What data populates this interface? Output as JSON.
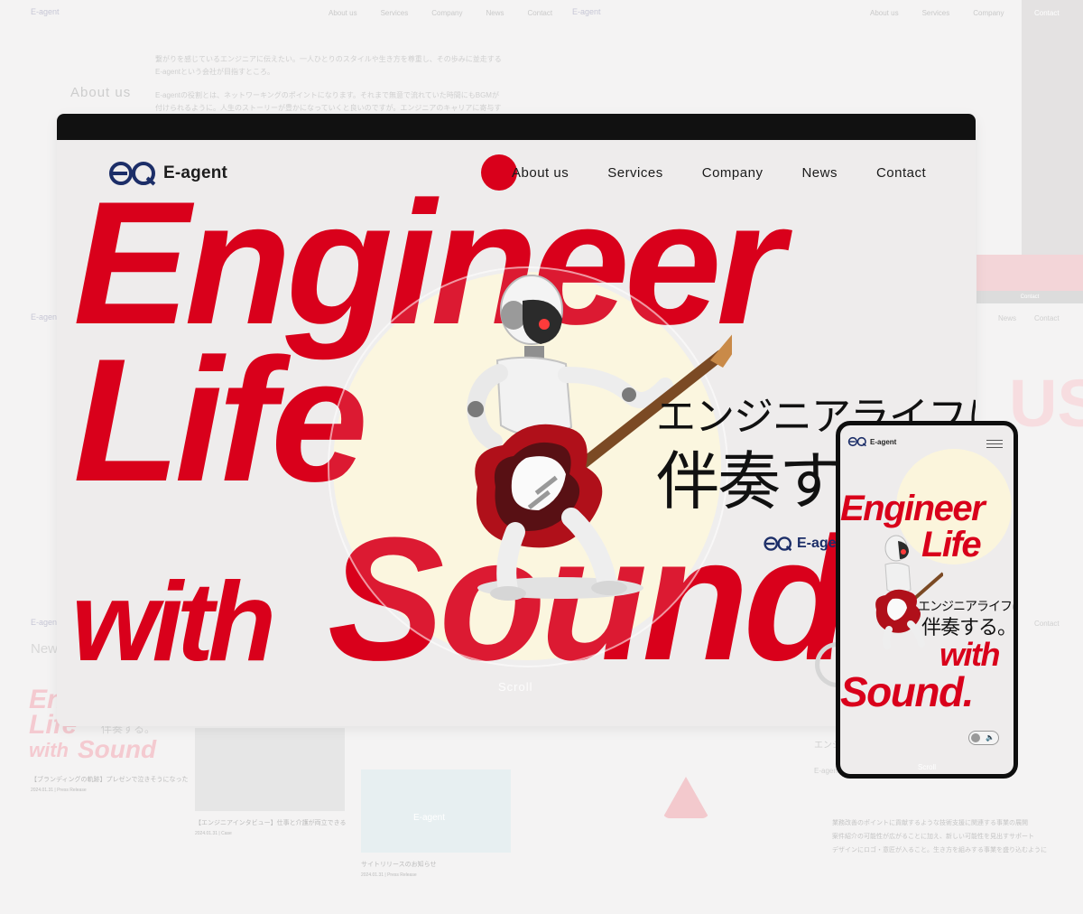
{
  "brand": {
    "name": "E-agent",
    "accent": "#d9001b",
    "logo_color": "#1c2e68"
  },
  "background": {
    "about_heading": "About us",
    "news_heading": "News",
    "nav": [
      "About us",
      "Services",
      "Company",
      "News",
      "Contact"
    ],
    "about_text_1": "繋がりを感じているエンジニアに伝えたい。一人ひとりのスタイルや生き方を尊重し、その歩みに並走する",
    "about_text_2": "E-agentという会社が目指すところ。",
    "about_text_3": "E-agentの役割とは、ネットワーキングのポイントになります。それまで無意で流れていた時間にもBGMが",
    "about_text_4": "付けられるように。人生のストーリーが豊かになっていくと良いのですが。エンジニアのキャリアに寄与す",
    "right_label": "Contact",
    "right_gray": "Contact",
    "us_text": "US",
    "news_1": "【ブランディングの軌跡】プレゼンで泣きそうになった",
    "news_1_meta": "2024.01.31 | Press Release",
    "news_2": "【エンジニアインタビュー】仕事と介護が両立できる",
    "news_2_meta": "2024.01.31 | Case",
    "news_3": "サイトリリースのお知らせ",
    "news_3_meta": "2024.01.31 | Press Release",
    "right_section": "エンジ",
    "right_body": "E-agentは、エンジニアの方々に寄り添い",
    "list_1": "業務改善のポイントに貢献するような技術支援に関連する事業の展開",
    "list_2": "案件紹介の可能性が広がることに加え、新しい可能性を見出すサポート",
    "list_3": "デザインにロゴ・意匠が入ること。生き方を組みする事業を盛り込むように"
  },
  "desktop": {
    "nav": [
      "About us",
      "Services",
      "Company",
      "News",
      "Contact"
    ],
    "hero_line_1": "Engineer",
    "hero_line_2": "Life",
    "hero_line_3": "with",
    "hero_line_4": "Sound",
    "jp_line_1": "エンジニアライフに、",
    "jp_line_2": "伴奏する。",
    "brand_under": "E-agent",
    "scroll_label": "Scroll"
  },
  "phone": {
    "logo": "E-agent",
    "hero_line_1": "Engineer",
    "hero_line_2": "Life",
    "hero_line_3": "with",
    "hero_line_4": "Sound.",
    "jp_line_1": "エンジニアライフに、",
    "jp_line_2": "伴奏する。",
    "sound_toggle_icon": "speaker-icon",
    "scroll_label": "Scroll"
  }
}
